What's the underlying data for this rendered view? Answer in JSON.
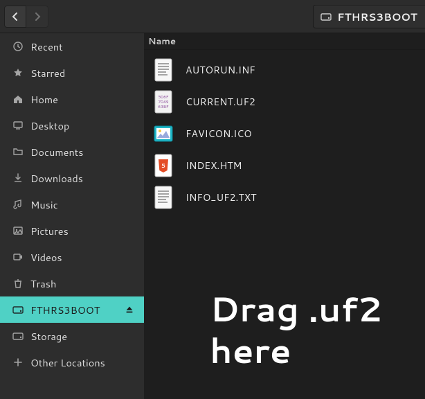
{
  "path": {
    "current": "FTHRS3BOOT"
  },
  "content": {
    "column_header": "Name",
    "drag_hint_line1": "Drag .uf2",
    "drag_hint_line2": "here"
  },
  "sidebar": {
    "items": [
      {
        "icon": "clock-icon",
        "label": "Recent"
      },
      {
        "icon": "star-icon",
        "label": "Starred"
      },
      {
        "icon": "home-icon",
        "label": "Home"
      },
      {
        "icon": "desktop-icon",
        "label": "Desktop"
      },
      {
        "icon": "folder-icon",
        "label": "Documents"
      },
      {
        "icon": "download-icon",
        "label": "Downloads"
      },
      {
        "icon": "music-icon",
        "label": "Music"
      },
      {
        "icon": "pictures-icon",
        "label": "Pictures"
      },
      {
        "icon": "videos-icon",
        "label": "Videos"
      },
      {
        "icon": "trash-icon",
        "label": "Trash"
      },
      {
        "icon": "drive-icon",
        "label": "FTHRS3BOOT",
        "selected": true,
        "ejectable": true
      },
      {
        "icon": "drive-icon",
        "label": "Storage"
      },
      {
        "icon": "plus-icon",
        "label": "Other Locations"
      }
    ]
  },
  "files": [
    {
      "icon": "text-file-icon",
      "name": "AUTORUN.INF"
    },
    {
      "icon": "binary-file-icon",
      "name": "CURRENT.UF2"
    },
    {
      "icon": "ico-file-icon",
      "name": "FAVICON.ICO"
    },
    {
      "icon": "html-file-icon",
      "name": "INDEX.HTM"
    },
    {
      "icon": "text-file-icon",
      "name": "INFO_UF2.TXT"
    }
  ]
}
